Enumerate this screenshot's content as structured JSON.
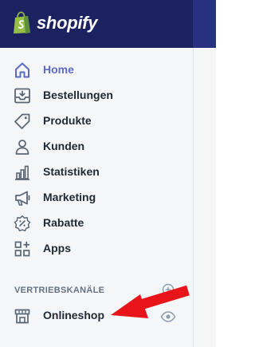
{
  "brand": {
    "name": "shopify",
    "icon": "shopify-bag-icon"
  },
  "colors": {
    "topbar": "#1c2260",
    "active": "#5c6ac4",
    "text": "#212b36",
    "icon": "#5c6774",
    "arrow": "#e8141a"
  },
  "nav": {
    "items": [
      {
        "label": "Home",
        "icon": "home-icon",
        "active": true
      },
      {
        "label": "Bestellungen",
        "icon": "orders-icon"
      },
      {
        "label": "Produkte",
        "icon": "tag-icon"
      },
      {
        "label": "Kunden",
        "icon": "person-icon"
      },
      {
        "label": "Statistiken",
        "icon": "bar-chart-icon"
      },
      {
        "label": "Marketing",
        "icon": "megaphone-icon"
      },
      {
        "label": "Rabatte",
        "icon": "discount-icon"
      },
      {
        "label": "Apps",
        "icon": "apps-grid-icon"
      }
    ]
  },
  "sales_channels": {
    "title": "VERTRIEBSKANÄLE",
    "add_icon": "plus-circle-icon",
    "items": [
      {
        "label": "Onlineshop",
        "icon": "store-icon",
        "action_icon": "eye-icon"
      }
    ]
  },
  "annotation": {
    "icon": "red-arrow-icon"
  }
}
